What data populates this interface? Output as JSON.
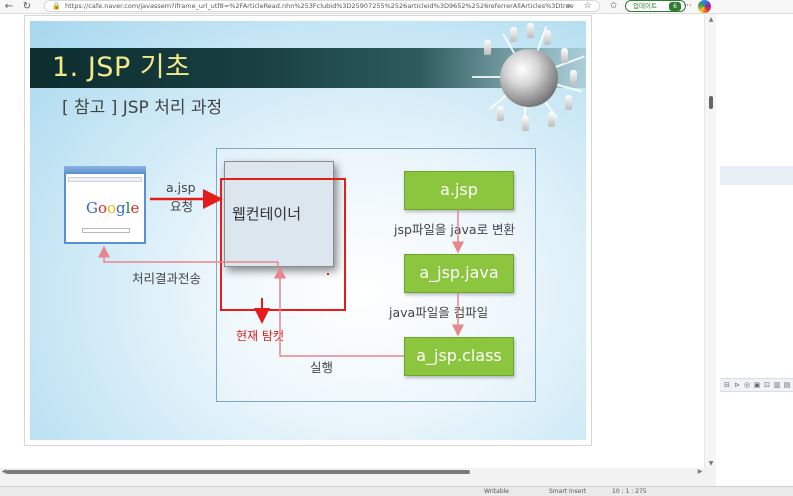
{
  "browser": {
    "url": "https://cafe.naver.com/javassem?iframe_url_utf8=%2FArticleRead.nhn%253Fclubid%3D25907255%2526articleid%3D9652%2526referrerAllArticles%3Dtrue",
    "update_label": "업데이트",
    "update_badge": "6"
  },
  "slide": {
    "title": "1. JSP 기초",
    "subtitle": "[ 참고 ] JSP 처리 과정",
    "google_logo": "Google",
    "request_line1": "a.jsp",
    "request_line2": "요청",
    "response_label": "처리결과전송",
    "web_container": "웹컨테이너",
    "box1": "a.jsp",
    "step1": "jsp파일을  java로 변환",
    "box2": "a_jsp.java",
    "step2": "java파일을  컴파일",
    "box3": "a_jsp.class",
    "execute": "실행"
  },
  "annotation": {
    "text": "현재 탐캣",
    "color": "#e51c1c"
  },
  "status": {
    "item1": "Writable",
    "item2": "Smart Insert",
    "item3": "10 : 1 : 275"
  },
  "colors": {
    "title_text": "#f4e98b",
    "title_band": "#183f42",
    "box_green": "#8cc63e",
    "frame_blue": "#7fa7c2",
    "arrow_pink": "#e7868d"
  }
}
